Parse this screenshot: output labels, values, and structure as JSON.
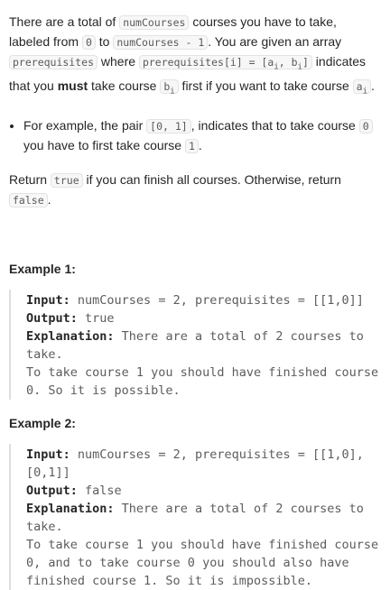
{
  "description": {
    "p1_a": "There are a total of ",
    "p1_code_numCourses": "numCourses",
    "p1_b": " courses you have to take, labeled from ",
    "p1_code_zero": "0",
    "p1_c": " to ",
    "p1_code_range_end": "numCourses - 1",
    "p1_d": ". You are given an array ",
    "p1_code_prereq": "prerequisites",
    "p1_e": " where ",
    "p1_code_prereq_i": "prerequisites[i] = [a",
    "p1_sub_i_1": "i",
    "p1_code_prereq_mid": ", b",
    "p1_sub_i_2": "i",
    "p1_code_prereq_end": "]",
    "p1_f": " indicates that you ",
    "p1_must": "must",
    "p1_g": " take course ",
    "p1_code_b": "b",
    "p1_sub_b": "i",
    "p1_h": " first if you want to take course ",
    "p1_code_a": "a",
    "p1_sub_a": "i",
    "p1_i": ".",
    "bullet_a": "For example, the pair ",
    "bullet_code_pair": "[0, 1]",
    "bullet_b": ", indicates that to take course ",
    "bullet_code_zero": "0",
    "bullet_c": " you have to first take course ",
    "bullet_code_one": "1",
    "bullet_d": ".",
    "ret_a": "Return ",
    "ret_code_true": "true",
    "ret_b": " if you can finish all courses. Otherwise, return ",
    "ret_code_false": "false",
    "ret_c": "."
  },
  "examples": [
    {
      "title": "Example 1:",
      "input_label": "Input:",
      "input_value": " numCourses = 2, prerequisites = [[1,0]]",
      "output_label": "Output:",
      "output_value": " true",
      "explanation_label": "Explanation:",
      "explanation_first": " There are a total of 2 courses to take.",
      "explanation_rest": "To take course 1 you should have finished course 0. So it is possible."
    },
    {
      "title": "Example 2:",
      "input_label": "Input:",
      "input_value": " numCourses = 2, prerequisites = [[1,0],[0,1]]",
      "output_label": "Output:",
      "output_value": " false",
      "explanation_label": "Explanation:",
      "explanation_first": " There are a total of 2 courses to take.",
      "explanation_rest": "To take course 1 you should have finished course 0, and to take course 0 you should also have finished course 1. So it is impossible."
    }
  ]
}
